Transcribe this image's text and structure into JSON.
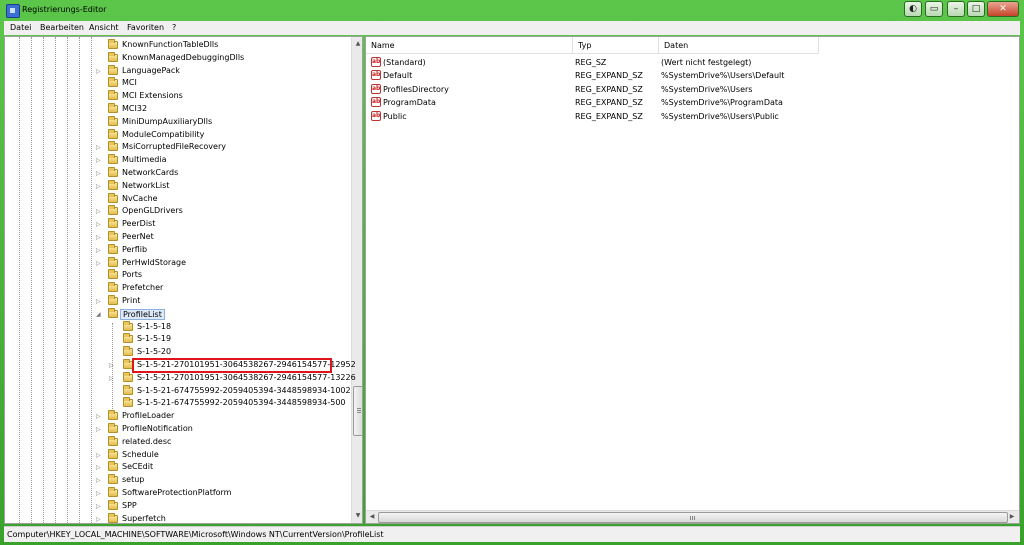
{
  "window": {
    "title": "Registrierungs-Editor",
    "controls": [
      "◐",
      "▭",
      "–",
      "□",
      "✕"
    ]
  },
  "menu": [
    {
      "label": "Datei"
    },
    {
      "label": "Bearbeiten"
    },
    {
      "label": "Ansicht"
    },
    {
      "label": "Favoriten"
    },
    {
      "label": "?"
    }
  ],
  "tree": {
    "top_items": [
      {
        "label": "KnownFunctionTableDlls",
        "expandable": false
      },
      {
        "label": "KnownManagedDebuggingDlls",
        "expandable": false
      },
      {
        "label": "LanguagePack",
        "expandable": true
      },
      {
        "label": "MCI",
        "expandable": false
      },
      {
        "label": "MCI Extensions",
        "expandable": false
      },
      {
        "label": "MCI32",
        "expandable": false
      },
      {
        "label": "MiniDumpAuxiliaryDlls",
        "expandable": false
      },
      {
        "label": "ModuleCompatibility",
        "expandable": false
      },
      {
        "label": "MsiCorruptedFileRecovery",
        "expandable": true
      },
      {
        "label": "Multimedia",
        "expandable": true
      },
      {
        "label": "NetworkCards",
        "expandable": true
      },
      {
        "label": "NetworkList",
        "expandable": true
      },
      {
        "label": "NvCache",
        "expandable": false
      },
      {
        "label": "OpenGLDrivers",
        "expandable": true
      },
      {
        "label": "PeerDist",
        "expandable": true
      },
      {
        "label": "PeerNet",
        "expandable": true
      },
      {
        "label": "Perflib",
        "expandable": true
      },
      {
        "label": "PerHwIdStorage",
        "expandable": true
      },
      {
        "label": "Ports",
        "expandable": false
      },
      {
        "label": "Prefetcher",
        "expandable": false
      },
      {
        "label": "Print",
        "expandable": true
      }
    ],
    "selected": {
      "label": "ProfileList",
      "expander": "◢"
    },
    "children": [
      {
        "label": "S-1-5-18",
        "expandable": false,
        "highlighted": false
      },
      {
        "label": "S-1-5-19",
        "expandable": false,
        "highlighted": false
      },
      {
        "label": "S-1-5-20",
        "expandable": false,
        "highlighted": false
      },
      {
        "label": "S-1-5-21-270101951-3064538267-2946154577-12952",
        "expandable": true,
        "highlighted": true
      },
      {
        "label": "S-1-5-21-270101951-3064538267-2946154577-13226",
        "expandable": true,
        "highlighted": false
      },
      {
        "label": "S-1-5-21-674755992-2059405394-3448598934-1002",
        "expandable": false,
        "highlighted": false
      },
      {
        "label": "S-1-5-21-674755992-2059405394-3448598934-500",
        "expandable": false,
        "highlighted": false
      }
    ],
    "bottom_items": [
      {
        "label": "ProfileLoader",
        "expandable": true
      },
      {
        "label": "ProfileNotification",
        "expandable": true
      },
      {
        "label": "related.desc",
        "expandable": false
      },
      {
        "label": "Schedule",
        "expandable": true
      },
      {
        "label": "SeCEdit",
        "expandable": true
      },
      {
        "label": "setup",
        "expandable": true
      },
      {
        "label": "SoftwareProtectionPlatform",
        "expandable": true
      },
      {
        "label": "SPP",
        "expandable": true
      },
      {
        "label": "Superfetch",
        "expandable": true
      }
    ],
    "expander_glyph": "▷",
    "scroll_up": "▲",
    "scroll_down": "▼"
  },
  "values_list": {
    "columns": [
      "Name",
      "Typ",
      "Daten"
    ],
    "rows": [
      {
        "name": "(Standard)",
        "type": "REG_SZ",
        "data": "(Wert nicht festgelegt)"
      },
      {
        "name": "Default",
        "type": "REG_EXPAND_SZ",
        "data": "%SystemDrive%\\Users\\Default"
      },
      {
        "name": "ProfilesDirectory",
        "type": "REG_EXPAND_SZ",
        "data": "%SystemDrive%\\Users"
      },
      {
        "name": "ProgramData",
        "type": "REG_EXPAND_SZ",
        "data": "%SystemDrive%\\ProgramData"
      },
      {
        "name": "Public",
        "type": "REG_EXPAND_SZ",
        "data": "%SystemDrive%\\Users\\Public"
      }
    ],
    "string_value_icon": "ab",
    "scroll_left": "◀",
    "scroll_right": "▶"
  },
  "status": {
    "path": "Computer\\HKEY_LOCAL_MACHINE\\SOFTWARE\\Microsoft\\Windows NT\\CurrentVersion\\ProfileList"
  },
  "colors": {
    "frame": "#39a22c",
    "highlight_box": "#e0141b",
    "folder": "#e2bd4e"
  }
}
